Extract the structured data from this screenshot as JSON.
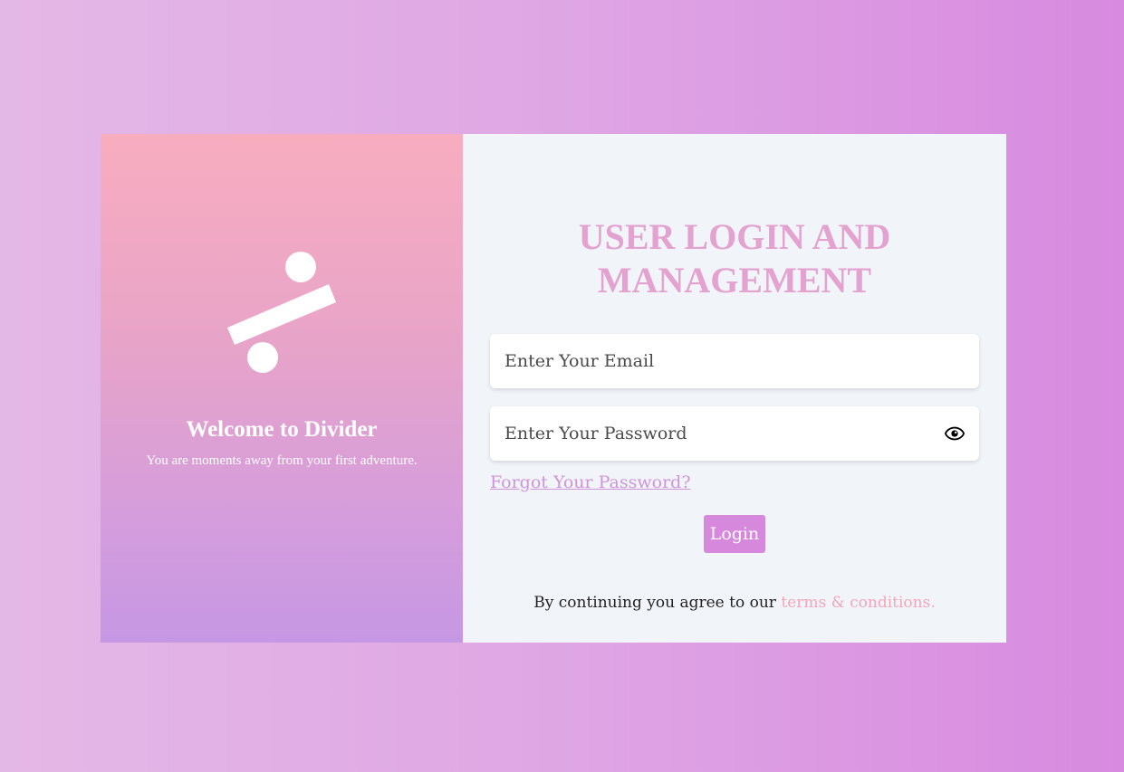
{
  "brand": {
    "logo_icon": "divide-sign-icon",
    "welcome_title": "Welcome to Divider",
    "welcome_subtitle": "You are moments away from your first adventure."
  },
  "login": {
    "heading": "USER LOGIN AND MANAGEMENT",
    "email_placeholder": "Enter Your Email",
    "email_value": "",
    "password_placeholder": "Enter Your Password",
    "password_value": "",
    "password_toggle_icon": "eye-icon",
    "forgot_label": "Forgot Your Password?",
    "login_label": "Login",
    "terms_prefix": "By continuing you agree to our ",
    "terms_link": "terms & conditions."
  },
  "colors": {
    "accent": "#d689dc",
    "heading": "#e3a2cf",
    "terms_link": "#f3a6b8",
    "panel_background": "#f1f4f8"
  }
}
